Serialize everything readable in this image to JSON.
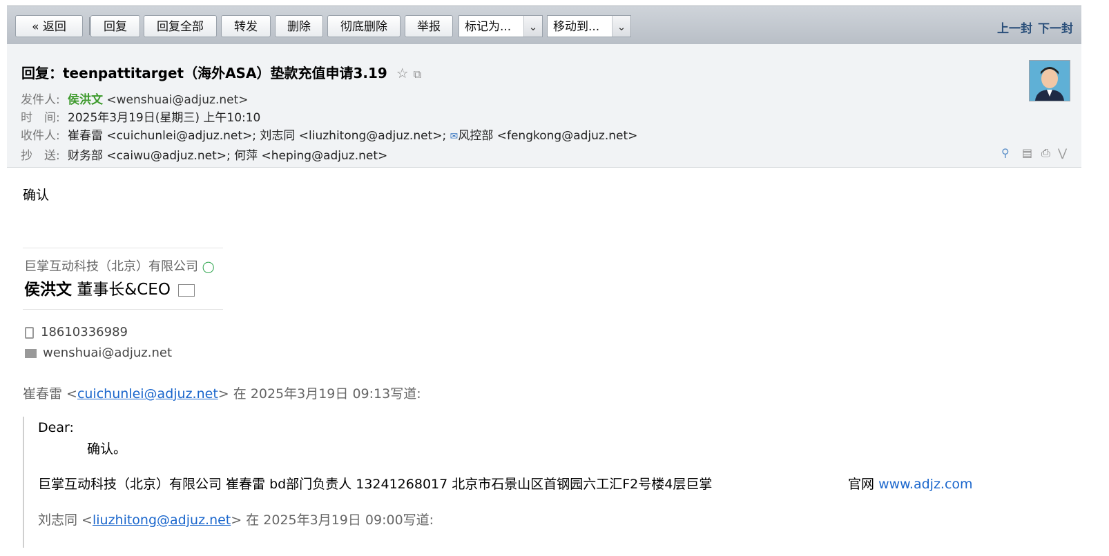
{
  "toolbar": {
    "back": "« 返回",
    "reply": "回复",
    "reply_all": "回复全部",
    "forward": "转发",
    "delete": "删除",
    "delete_perm": "彻底删除",
    "report": "举报",
    "mark_as": "标记为...",
    "move_to": "移动到...",
    "prev": "上一封",
    "next": "下一封"
  },
  "header": {
    "subject": "回复：teenpattitarget（海外ASA）垫款充值申请3.19",
    "from_label": "发件人:",
    "from_name": "侯洪文",
    "from_addr": "<wenshuai@adjuz.net>",
    "time_label": "时　间:",
    "time_value": "2025年3月19日(星期三) 上午10:10",
    "to_label": "收件人:",
    "to_value_1": "崔春雷 <cuichunlei@adjuz.net>; 刘志同 <liuzhitong@adjuz.net>;",
    "to_value_2": "风控部 <fengkong@adjuz.net>",
    "cc_label": "抄　送:",
    "cc_value": "财务部 <caiwu@adjuz.net>; 何萍 <heping@adjuz.net>"
  },
  "body": {
    "confirm": "确认",
    "sig_company": "巨掌互动科技（北京）有限公司",
    "sig_name": "侯洪文",
    "sig_title": "董事长&CEO",
    "sig_phone": "18610336989",
    "sig_email": "wenshuai@adjuz.net",
    "quote1_name": "崔春雷 <",
    "quote1_email": "cuichunlei@adjuz.net",
    "quote1_tail": "> 在 2025年3月19日 09:13写道:",
    "q_dear": "Dear:",
    "q_confirm": "确认。",
    "q_sig": "巨掌互动科技（北京）有限公司 崔春雷   bd部门负责人    13241268017 北京市石景山区首钢园六工汇F2号楼4层巨掌",
    "q_site_label": "官网",
    "q_site": "www.adjz.com",
    "quote2_name": "刘志同 <",
    "quote2_email": "liuzhitong@adjuz.net",
    "quote2_tail": "> 在 2025年3月19日 09:00写道:"
  },
  "colors": {
    "sender_name": "#3d9a2c",
    "link": "#1a66cc",
    "nav": "#2a4f7a"
  }
}
